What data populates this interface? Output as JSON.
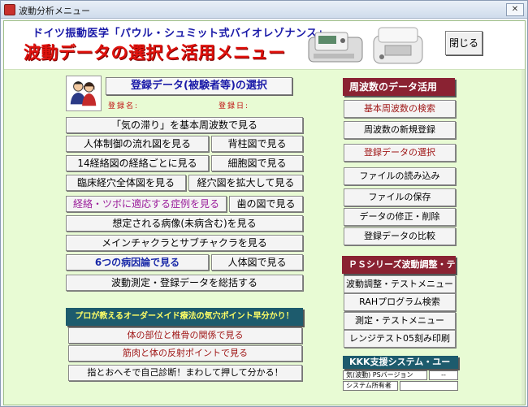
{
  "window": {
    "title": "波動分析メニュー",
    "close_glyph": "✕"
  },
  "header": {
    "subtitle": "ドイツ振動医学「パウル・シュミット式バイオレゾナンス」",
    "title": "波動データの選択と活用メニュー",
    "close_label": "閉じる"
  },
  "registration": {
    "button_label": "登録データ(被験者等)の選択",
    "name_label": "登録名:",
    "date_label": "登録日:"
  },
  "grid": {
    "b1": "「気の滞り」を基本周波数で見る",
    "b2": "人体制御の流れ図を見る",
    "b3": "背柱図で見る",
    "b4": "14経絡図の経絡ごとに見る",
    "b5": "細胞図で見る",
    "b6": "臨床経穴全体図を見る",
    "b7": "経穴図を拡大して見る",
    "b8": "経絡・ツボに適応する症例を見る",
    "b9": "歯の図で見る",
    "b10": "想定される病像(未病含む)を見る",
    "b11": "メインチャクラとサブチャクラを見る",
    "b12": "6つの病因論で見る",
    "b13": "人体図で見る",
    "b14": "波動測定・登録データを総括する"
  },
  "frequency": {
    "header": "周波数のデータ活用",
    "items": [
      "基本周波数の検索",
      "周波数の新規登録",
      "登録データの選択",
      "ファイルの読み込み",
      "ファイルの保存",
      "データの修正・削除",
      "登録データの比較"
    ]
  },
  "ps": {
    "header": "ＰＳシリーズ波動調整・テスト",
    "items": [
      "波動調整・テストメニュー",
      "RAHプログラム検索",
      "測定・テストメニュー",
      "レンジテスト05刻み印刷"
    ]
  },
  "promo": {
    "header": "プロが教えるオーダーメイド療法の気穴ポイント早分かり！",
    "items": [
      "体の部位と椎骨の関係で見る",
      "筋肉と体の反射ポイントで見る",
      "指とおへそで自己診断！まわして押して分かる！"
    ]
  },
  "kkk": {
    "header": "KKK支援システム・ユーザー",
    "row1_label": "気(波動) PSバージョン",
    "row1_value": "--",
    "row2_label": "システム所有者"
  },
  "colors": {
    "form_bg": "#e8fbd4",
    "title_red": "#e0120d",
    "subtitle_blue": "#1a1aa8",
    "section_maroon": "#8a2232",
    "section_teal": "#1d5b6d"
  }
}
